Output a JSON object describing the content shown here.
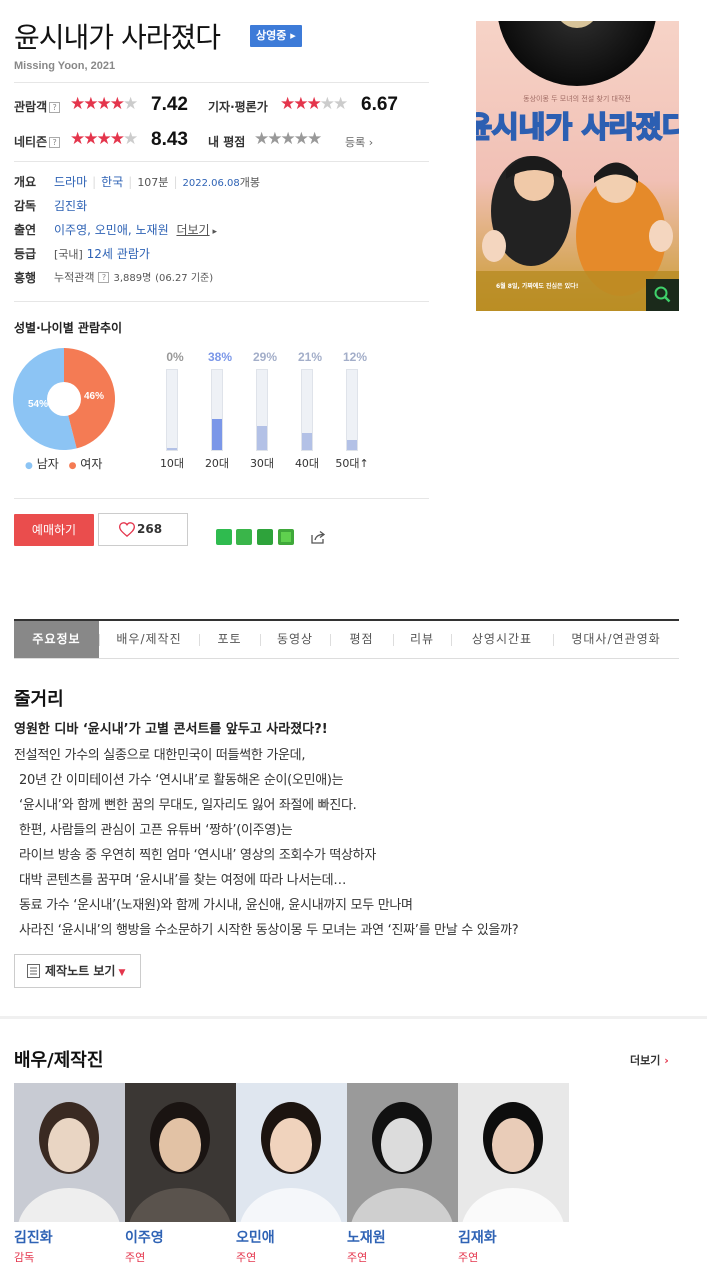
{
  "header": {
    "title": "윤시내가 사라졌다",
    "status_badge": "상영중 ▸",
    "subtitle": "Missing Yoon, 2021"
  },
  "ratings": {
    "audience": {
      "label": "관람객",
      "score": "7.42",
      "stars": 3.7
    },
    "critics": {
      "label": "기자·평론가",
      "score": "6.67",
      "stars": 3.3
    },
    "netizen": {
      "label": "네티즌",
      "score": "8.43",
      "stars": 4.2
    },
    "mine": {
      "label": "내 평점",
      "action": "등록",
      "stars": 0
    }
  },
  "info": {
    "overview": {
      "label": "개요",
      "genre": "드라마",
      "country": "한국",
      "runtime": "107분",
      "release_date": "2022.06.08",
      "release_suffix": "개봉"
    },
    "director": {
      "label": "감독",
      "name": "김진화"
    },
    "cast": {
      "label": "출연",
      "names": "이주영, 오민애, 노재원",
      "more": "더보기"
    },
    "grade": {
      "label": "등급",
      "prefix": "[국내]",
      "value": "12세 관람가"
    },
    "boxoffice": {
      "label": "흥행",
      "metric": "누적관객",
      "value": "3,889명",
      "date": "(06.27 기준)"
    }
  },
  "demographics": {
    "title": "성별·나이별 관람추이",
    "gender": {
      "male_label": "남자",
      "female_label": "여자",
      "male_pct": 54,
      "female_pct": 46,
      "male_text": "54%",
      "female_text": "46%",
      "male_color": "#8cc4f4",
      "female_color": "#f47b54"
    },
    "age": [
      {
        "label": "10대",
        "pct": 0,
        "text": "0%"
      },
      {
        "label": "20대",
        "pct": 38,
        "text": "38%"
      },
      {
        "label": "30대",
        "pct": 29,
        "text": "29%"
      },
      {
        "label": "40대",
        "pct": 21,
        "text": "21%"
      },
      {
        "label": "50대↑",
        "pct": 12,
        "text": "12%"
      }
    ]
  },
  "actions": {
    "reserve": "예매하기",
    "like_count": "268"
  },
  "tabs": [
    "주요정보",
    "배우/제작진",
    "포토",
    "동영상",
    "평점",
    "리뷰",
    "상영시간표",
    "명대사/연관영화"
  ],
  "synopsis": {
    "heading": "줄거리",
    "lead": "영원한 디바 ‘윤시내’가 고별 콘서트를 앞두고 사라졌다?!",
    "lines": [
      "전설적인 가수의 실종으로 대한민국이 떠들썩한 가운데,",
      "20년 간 이미테이션 가수 ‘연시내’로 활동해온 순이(오민애)는",
      "‘윤시내’와 함께 뻔한 꿈의 무대도, 일자리도 잃어 좌절에 빠진다.",
      "한편, 사람들의 관심이 고픈 유튜버 ‘짱하’(이주영)는",
      "라이브 방송 중 우연히 찍힌 엄마 ‘연시내’ 영상의 조회수가 떡상하자",
      "대박 콘텐츠를 꿈꾸며 ‘윤시내’를 찾는 여정에 따라 나서는데…",
      "동료 가수 ‘운시내’(노재원)와 함께 가시내, 윤신애, 윤시내까지 모두 만나며",
      "사라진 ‘윤시내’의 행방을 수소문하기 시작한 동상이몽 두 모녀는 과연 ‘진짜’를 만날 수 있을까?"
    ],
    "notes_button": "제작노트 보기"
  },
  "cast_section": {
    "heading": "배우/제작진",
    "more": "더보기",
    "members": [
      {
        "name": "김진화",
        "role": "감독"
      },
      {
        "name": "이주영",
        "role": "주연"
      },
      {
        "name": "오민애",
        "role": "주연"
      },
      {
        "name": "노재원",
        "role": "주연"
      },
      {
        "name": "김재화",
        "role": "주연"
      }
    ]
  },
  "poster": {
    "title_text": "윤시내가 사라졌다",
    "tagline": "동상이몽 두 모녀의 전설 찾기 대작전",
    "bottom_text": "6월 8일, 가짜에도 진심은 있다!"
  },
  "colors": {
    "accent_red": "#e4354c",
    "link_blue": "#2f63b5",
    "badge_blue": "#3d7bd8",
    "age_bar_hi": "#7b97e8",
    "age_bar": "#b3c1e6"
  }
}
